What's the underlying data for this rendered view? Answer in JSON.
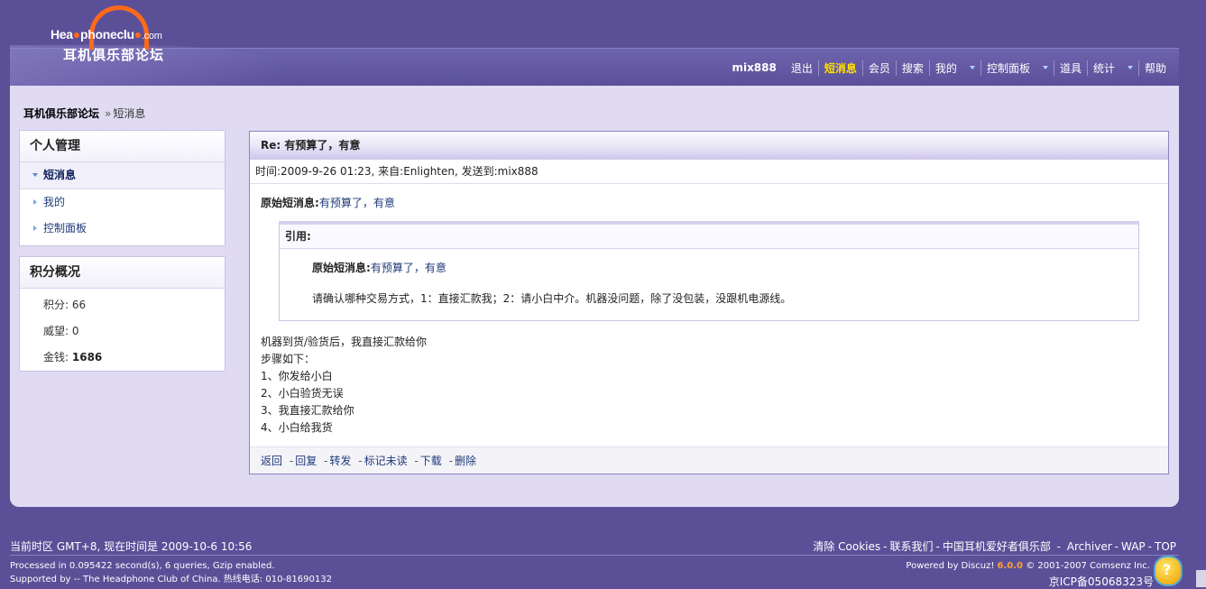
{
  "header": {
    "logo_text_a": "Hea",
    "logo_text_b": "phoneclu",
    "logo_text_c": ".com",
    "logo_subtitle": "耳机俱乐部论坛",
    "username": "mix888",
    "nav": [
      {
        "label": "退出"
      },
      {
        "label": "短消息",
        "active": true
      },
      {
        "label": "会员"
      },
      {
        "label": "搜索"
      },
      {
        "label": "我的",
        "dropdown": true
      },
      {
        "label": "控制面板",
        "dropdown": true
      },
      {
        "label": "道具"
      },
      {
        "label": "统计",
        "dropdown": true
      },
      {
        "label": "帮助"
      }
    ]
  },
  "breadcrumb": {
    "home": "耳机俱乐部论坛",
    "separator": "»",
    "current": "短消息"
  },
  "sidebar": {
    "personal": {
      "title": "个人管理",
      "items": [
        {
          "label": "短消息",
          "current": true
        },
        {
          "label": "我的"
        },
        {
          "label": "控制面板"
        }
      ]
    },
    "credits": {
      "title": "积分概况",
      "rows": [
        {
          "label": "积分:",
          "value": "66"
        },
        {
          "label": "威望:",
          "value": "0"
        },
        {
          "label": "金钱:",
          "value": "1686"
        }
      ]
    }
  },
  "message": {
    "title": "Re: 有预算了，有意",
    "meta": "时间:2009-9-26 01:23, 来自:Enlighten, 发送到:mix888",
    "original_label": "原始短消息:",
    "original_link": "有预算了，有意",
    "quote": {
      "title": "引用:",
      "original_label": "原始短消息:",
      "original_link": "有预算了，有意",
      "text": "请确认哪种交易方式，1：直接汇款我；2：请小白中介。机器没问题，除了没包装，没跟机电源线。"
    },
    "reply_lines": [
      "机器到货/验货后，我直接汇款给你",
      "步骤如下：",
      "1、你发给小白",
      "2、小白验货无误",
      "3、我直接汇款给你",
      "4、小白给我货"
    ],
    "actions": [
      "返回",
      "回复",
      "转发",
      "标记未读",
      "下载",
      "删除"
    ],
    "action_separator": "-"
  },
  "footer": {
    "timezone_text": "当前时区  GMT+8, 现在时间是  2009-10-6 10:56",
    "links": [
      "清除  Cookies",
      "联系我们",
      "中国耳机爱好者俱乐部",
      "Archiver",
      "WAP",
      "TOP"
    ],
    "processed": "Processed in 0.095422 second(s), 6 queries, Gzip enabled.",
    "supported": "Supported by -- The Headphone Club of China. 热线电话: 010-81690132",
    "powered_prefix": "Powered by Discuz!",
    "powered_version": "6.0.0",
    "powered_suffix": "© 2001-2007 Comsenz Inc.",
    "icp": "京ICP备05068323号"
  },
  "colors": {
    "page_bg": "#5b4f98",
    "content_bg": "#e0dbf2",
    "active_nav": "#ffe000",
    "logo_ring": "#ff6a1a",
    "discuz_version": "#ffa238"
  }
}
